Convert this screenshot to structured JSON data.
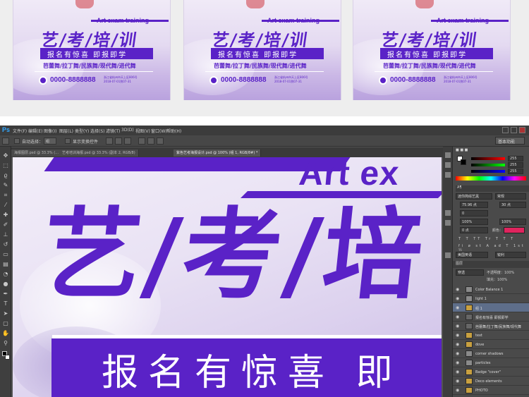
{
  "preview": {
    "posters": [
      {
        "tag": "Art exam training",
        "title": "艺/考/培/训",
        "subtitle": "报名有惊喜 即报即学",
        "dances": "芭蕾舞/拉丁舞/民族舞/现代舞/进代舞",
        "phone": "0000-8888888",
        "address": "浙江省杭州市天上区806号",
        "date": "2018-07-01到07-31"
      },
      {
        "tag": "Art exam training",
        "title": "艺/考/培/训",
        "subtitle": "报名有惊喜 即报即学",
        "dances": "芭蕾舞/拉丁舞/民族舞/现代舞/进代舞",
        "phone": "0000-8888888",
        "address": "浙江省杭州市天上区806号",
        "date": "2018-07-01到07-31"
      },
      {
        "tag": "Art exam training",
        "title": "艺/考/培/训",
        "subtitle": "报名有惊喜 即报即学",
        "dances": "芭蕾舞/拉丁舞/民族舞/现代舞/进代舞",
        "phone": "0000-8888888",
        "address": "浙江省杭州市天上区806号",
        "date": "2018-07-01到07-31"
      }
    ]
  },
  "ps": {
    "app_logo": "Ps",
    "menu": [
      "文件(F)",
      "编辑(E)",
      "图像(I)",
      "图层(L)",
      "类型(Y)",
      "选择(S)",
      "滤镜(T)",
      "3D(D)",
      "视图(V)",
      "窗口(W)",
      "帮助(H)"
    ],
    "options": {
      "auto_select": "自动选择：",
      "group": "组",
      "show_transform": "显示变换控件"
    },
    "workspace": "基本功能",
    "tabs": [
      "海报图层.psd @ 33.3% (…",
      "艺考培训海报.psd @ 33.3% (副本 2, RGB/8)",
      "紫色艺考海报设计.psd @ 100% (组 1, RGB/8#) *"
    ],
    "canvas": {
      "art_text": "Art ex",
      "big_title": "艺/考/培",
      "subtitle": "报名有惊喜 即"
    },
    "panels": {
      "color_values": [
        "255",
        "255",
        "255"
      ],
      "char_font": "迷你简综艺黑",
      "char_style": "常规",
      "char_size": "75.96 点",
      "char_leading": "30 点",
      "char_tracking": "0",
      "char_scale": "100%",
      "char_scale2": "100%",
      "char_baseline": "0 点",
      "color_label": "颜色：",
      "lang": "美国英语",
      "aa": "锐利",
      "layers_header": "图层",
      "blend_mode": "穿透",
      "opacity": "不透明度：100%",
      "fill": "填充：100%",
      "layers": [
        {
          "name": "Color Balance 1",
          "sel": false
        },
        {
          "name": "light 1",
          "sel": false
        },
        {
          "name": "组 1",
          "sel": true
        },
        {
          "name": "报名有惊喜 即报即学",
          "sel": false
        },
        {
          "name": "芭蕾舞/拉丁舞/民族舞/现代舞",
          "sel": false
        },
        {
          "name": "text",
          "sel": false
        },
        {
          "name": "dove",
          "sel": false
        },
        {
          "name": "corner shadows",
          "sel": false
        },
        {
          "name": "particles",
          "sel": false
        },
        {
          "name": "Badge \"cover\"",
          "sel": false
        },
        {
          "name": "Deco elements",
          "sel": false
        },
        {
          "name": "PHOTO",
          "sel": false
        }
      ]
    }
  },
  "colors": {
    "brand_purple": "#5a22c7",
    "ps_dark": "#3c3c3c",
    "ps_panel": "#4a4a4a",
    "accent_pink": "#e0245e"
  }
}
